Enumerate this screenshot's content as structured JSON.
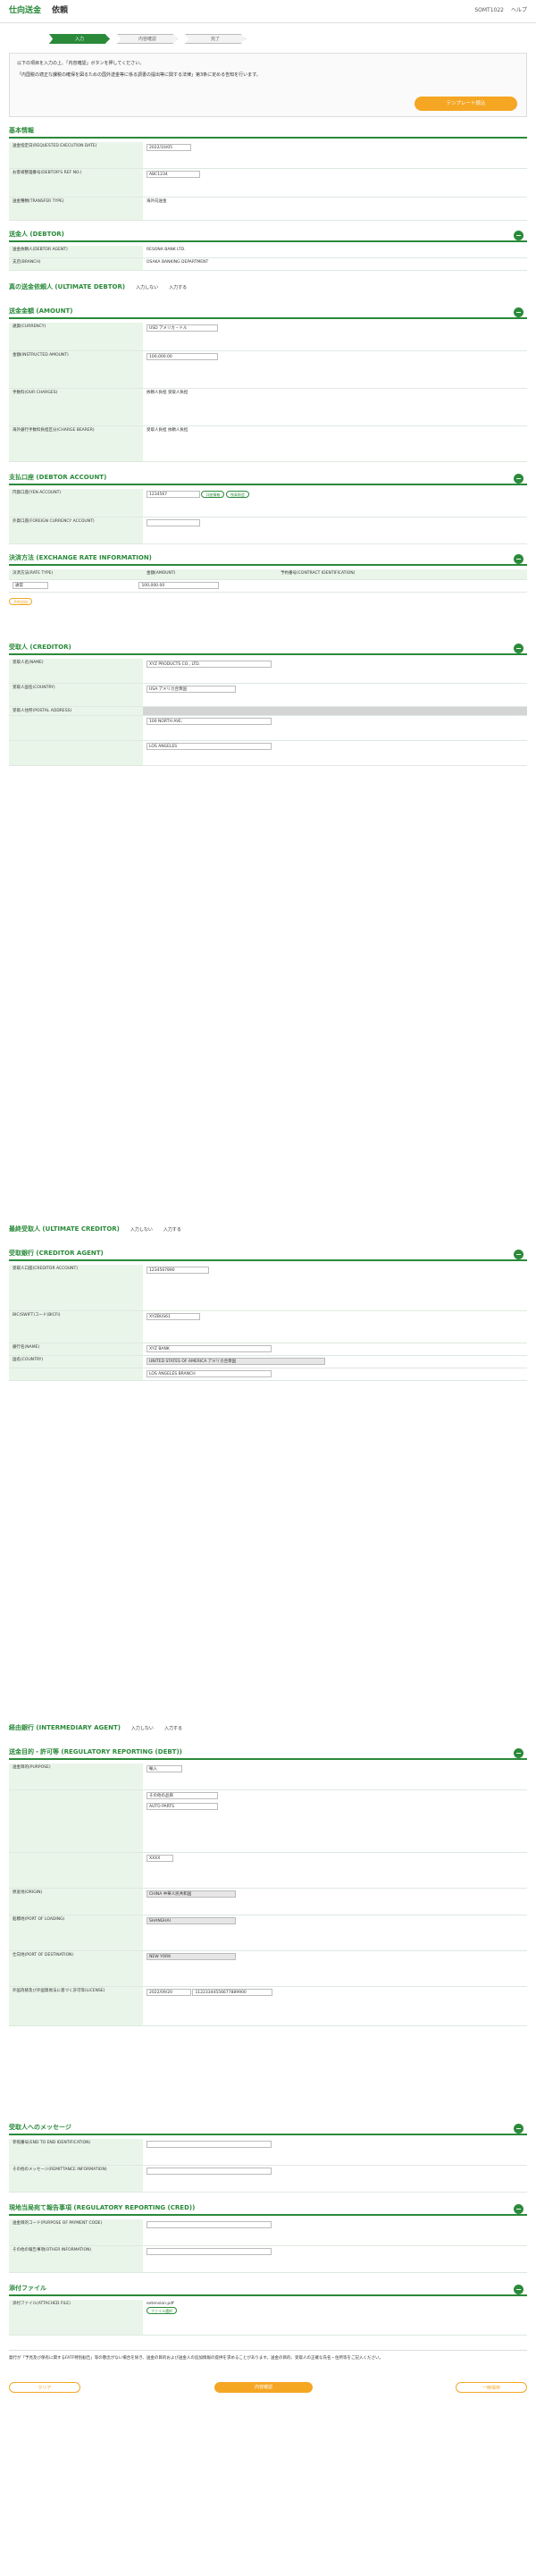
{
  "header": {
    "title": "仕向送金",
    "subtitle": "依頼",
    "user": "SOMT1022",
    "help": "ヘルプ"
  },
  "steps": [
    "入力",
    "内容確認",
    "完了"
  ],
  "intro": {
    "line1": "以下の項目を入力の上、「内容確認」ボタンを押してください。",
    "line2": "「内国税の適正な課税の確保を図るための国外送金等に係る調書の提出等に関する法律」第3条に定める告知を行います。",
    "template_button": "テンプレート読込"
  },
  "basic": {
    "title": "基本情報",
    "date_label": "送金指定日(REQUESTED EXECUTION DATE)",
    "date_value": "2022/10/05",
    "ref_label": "お客様整理番号(DEBTOR'S REF NO.)",
    "ref_value": "ABC1234",
    "transfer_label": "送金種類(TRANSFER TYPE)",
    "transfer_value": "海外向送金"
  },
  "debtor": {
    "title": "送金人 (DEBTOR)",
    "agent_label": "送金依頼人(DEBTOR AGENT)",
    "agent_value": "RESONA BANK LTD.",
    "branch_label": "支店(BRANCH)",
    "branch_value": "OSAKA BANKING DEPARTMENT"
  },
  "ultdebtor": {
    "title": "真の送金依頼人 (ULTIMATE DEBTOR)",
    "opt1": "入力しない",
    "opt2": "入力する"
  },
  "amount": {
    "title": "送金金額 (AMOUNT)",
    "currency_label": "通貨(CURRENCY)",
    "currency_value": "USD アメリカ・ドル",
    "amount_label": "金額(INSTRUCTED AMOUNT)",
    "amount_value": "100,000.00",
    "fee_label": "手数料(OUR CHARGES)",
    "fee_opt1": "依頼人負担",
    "fee_opt2": "受取人負担",
    "overseas_label": "海外銀行手数料負担区分(CHARGE BEARER)",
    "overseas_opt1": "受取人負担",
    "overseas_opt2": "依頼人負担"
  },
  "account": {
    "title": "支払口座 (DEBTOR ACCOUNT)",
    "yen_label": "円貨口座(YEN ACCOUNT)",
    "yen_value": "1234567",
    "fx_label": "外貨口座(FOREIGN CURRENCY ACCOUNT)",
    "btn1": "口座情報",
    "btn2": "残高照会"
  },
  "rate": {
    "title": "決済方法 (EXCHANGE RATE INFORMATION)",
    "col1": "決済方法(RATE TYPE)",
    "col2": "金額(AMOUNT)",
    "col3": "予約番号(CONTRACT IDENTIFICATION)",
    "type_value": "通常",
    "amount_value": "100,000.00",
    "add_button": "予約追加"
  },
  "creditor": {
    "title": "受取人 (CREDITOR)",
    "name_label": "受取人名(NAME)",
    "name_value": "XYZ PRODUCTS CO., LTD.",
    "country_label": "受取人国名(COUNTRY)",
    "country_value": "USA アメリカ合衆国",
    "address_label": "受取人住所(POSTAL ADDRESS)",
    "street_value": "100 NORTH AVE.",
    "town_value": "LOS ANGELES"
  },
  "ultcreditor": {
    "title": "最終受取人 (ULTIMATE CREDITOR)",
    "opt1": "入力しない",
    "opt2": "入力する"
  },
  "agent": {
    "title": "受取銀行 (CREDITOR AGENT)",
    "ibank_label": "受取人口座(CREDITOR ACCOUNT)",
    "iban_value": "1234567890",
    "bic_label": "BIC(SWIFT)コード(BICFI)",
    "bic_value": "XYZBUS61",
    "name_label": "銀行名(NAME)",
    "name_value": "XYZ BANK",
    "country_label": "国名(COUNTRY)",
    "country_value": "UNITED STATES OF AMERICA アメリカ合衆国",
    "branch_value": "LOS ANGELES BRANCH"
  },
  "intermediary": {
    "title": "経由銀行 (INTERMEDIARY AGENT)",
    "opt1": "入力しない",
    "opt2": "入力する"
  },
  "regulatory": {
    "title": "送金目的・許可等 (REGULATORY REPORTING (DEBT))",
    "purpose_label": "送金目的(PURPOSE)",
    "purpose_value": "輸入",
    "category_value": "その他の品目",
    "item_value": "AUTO PARTS",
    "code_value": "XXXX",
    "origin_label": "原産地(ORIGIN)",
    "origin_value": "CHINA 中華人民共和国",
    "loading_label": "船積地(PORT OF LOADING)",
    "loading_value": "SHANGHAI",
    "dest_label": "仕向地(PORT OF DESTINATION)",
    "dest_value": "NEW YORK",
    "license_label": "外国為替及び外国貿易法に基づく許可等(LICENSE)",
    "license_date": "2022/09/20",
    "license_no": "11223344556677889900"
  },
  "message": {
    "title": "受取人へのメッセージ",
    "label1": "参照番号(END TO END IDENTIFICATION)",
    "label2": "その他のメッセージ(REMITTANCE INFORMATION)"
  },
  "cred": {
    "title": "現地当局宛て報告事項 (REGULATORY REPORTING (CRED))",
    "label1": "送金目的コード(PURPOSE OF PAYMENT CODE)",
    "label2": "その他の報告事項(OTHER INFORMATION)"
  },
  "files": {
    "title": "添付ファイル",
    "label": "添付ファイル(ATTACHED FILE)",
    "file_value": "extension.pdf",
    "btn": "ファイル選択"
  },
  "footer": {
    "note": "発行が「予見及び保有に関するFATF特別勧告」等の懸念がない場合を除き、送金の目的および送金人の追加情報の提供を求めることがあります。送金の目的、受取人の正確な氏名・住所等をご記入ください。",
    "clear": "クリア",
    "confirm": "内容確認",
    "save": "一時保存"
  }
}
